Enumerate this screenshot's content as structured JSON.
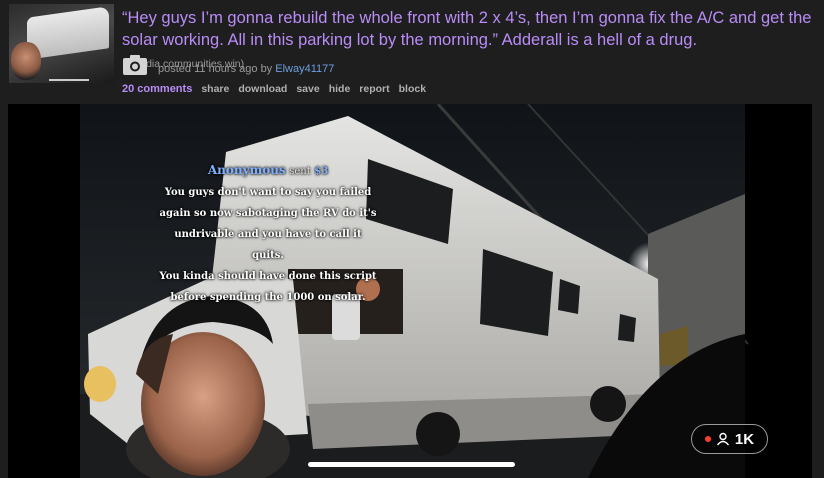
{
  "post": {
    "title": "“Hey guys I’m gonna rebuild the whole front with 2 x 4’s, then I’m gonna fix the A/C and get the solar working. All in this parking lot by the morning.” Adderall is a hell of a drug.",
    "domain": "(media.communities.win)",
    "posted_prefix": "posted",
    "time": "11 hours ago",
    "by": "by",
    "author": "Elway41177"
  },
  "actions": {
    "comments": "20 comments",
    "share": "share",
    "download": "download",
    "save": "save",
    "hide": "hide",
    "report": "report",
    "block": "block"
  },
  "video": {
    "caption": {
      "sender": "Anonymous",
      "sent_word": "sent",
      "amount": "$3",
      "lines": [
        "You guys don't want to say you failed",
        "again so now sabotaging the RV do it's",
        "undrivable and you have to call it quits.",
        "You kinda should have done this script",
        "before spending the 1000 on solar."
      ]
    },
    "viewers": "1K"
  },
  "icons": {
    "media_type": "camera-icon",
    "viewers": "person-icon",
    "live": "live-dot-icon"
  },
  "colors": {
    "title": "#b98cf7",
    "author": "#6e9ee0",
    "background": "#1e1e1e",
    "live": "#ff3b30"
  }
}
